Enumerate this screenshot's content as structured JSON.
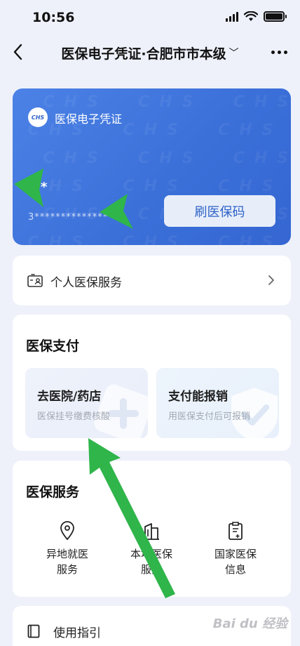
{
  "status_bar": {
    "time": "10:56"
  },
  "nav": {
    "title": "医保电子凭证·合肥市市本级",
    "back_icon": "back-arrow-icon",
    "more_icon": "more-dots-icon"
  },
  "card": {
    "logo_text": "CHS",
    "title": "医保电子凭证",
    "name": "*",
    "number": "3**************",
    "button_label": "刷医保码"
  },
  "personal_service": {
    "label": "个人医保服务"
  },
  "payment": {
    "title": "医保支付",
    "tiles": [
      {
        "title": "去医院/药店",
        "subtitle": "医保挂号缴费核酸"
      },
      {
        "title": "支付能报销",
        "subtitle": "用医保支付后可报销"
      }
    ]
  },
  "services": {
    "title": "医保服务",
    "items": [
      {
        "label_line1": "异地就医",
        "label_line2": "服务",
        "icon": "location-pin-icon"
      },
      {
        "label_line1": "本地医保",
        "label_line2": "服务",
        "icon": "building-icon"
      },
      {
        "label_line1": "国家医保",
        "label_line2": "信息",
        "icon": "document-icon"
      }
    ]
  },
  "guide": {
    "label": "使用指引"
  },
  "watermark": {
    "text": "Bai du 经验"
  },
  "colors": {
    "card_blue": "#3a6fd8",
    "accent_blue": "#2e63c8",
    "annotation_green": "#2fb54a"
  }
}
